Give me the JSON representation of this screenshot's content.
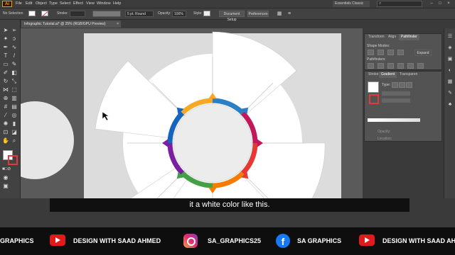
{
  "app": {
    "logo": "Ai"
  },
  "menu": [
    "File",
    "Edit",
    "Object",
    "Type",
    "Select",
    "Effect",
    "View",
    "Window",
    "Help"
  ],
  "workspace": "Essentials Classic",
  "control_bar": {
    "selection": "No Selection",
    "stroke_label": "Stroke:",
    "brush": "5 pt. Round",
    "opacity_label": "Opacity:",
    "opacity_value": "100%",
    "style_label": "Style:",
    "doc_setup": "Document Setup",
    "preferences": "Preferences"
  },
  "doc_tab": {
    "title": "Infographic Tutorial.ai* @ 25% (RGB/GPU Preview)",
    "close": "×"
  },
  "panel_pathfinder": {
    "tabs": [
      "Transform",
      "Align",
      "Pathfinder"
    ],
    "shape_modes": "Shape Modes:",
    "pathfinders": "Pathfinders:",
    "expand": "Expand"
  },
  "panel_gradient": {
    "tabs": [
      "Stroke",
      "Gradient",
      "Transparen"
    ],
    "type_label": "Type:",
    "opacity_label": "Opacity:",
    "location_label": "Location:"
  },
  "caption": "it a white color like this.",
  "social": [
    {
      "icon": "youtube-icon",
      "text": "GRAPHICS"
    },
    {
      "icon": "youtube-icon",
      "text": "DESIGN WITH SAAD AHMED"
    },
    {
      "icon": "instagram-icon",
      "text": "SA_GRAPHICS25"
    },
    {
      "icon": "facebook-icon",
      "text": "SA GRAPHICS"
    },
    {
      "icon": "youtube-icon",
      "text": "DESIGN WITH SAAD AHMED"
    }
  ],
  "infographic_colors": [
    "#2b7fc4",
    "#c2185b",
    "#e53935",
    "#f57c00",
    "#43a047",
    "#7b1fa2",
    "#1565c0",
    "#f9a825",
    "#00acc1"
  ]
}
